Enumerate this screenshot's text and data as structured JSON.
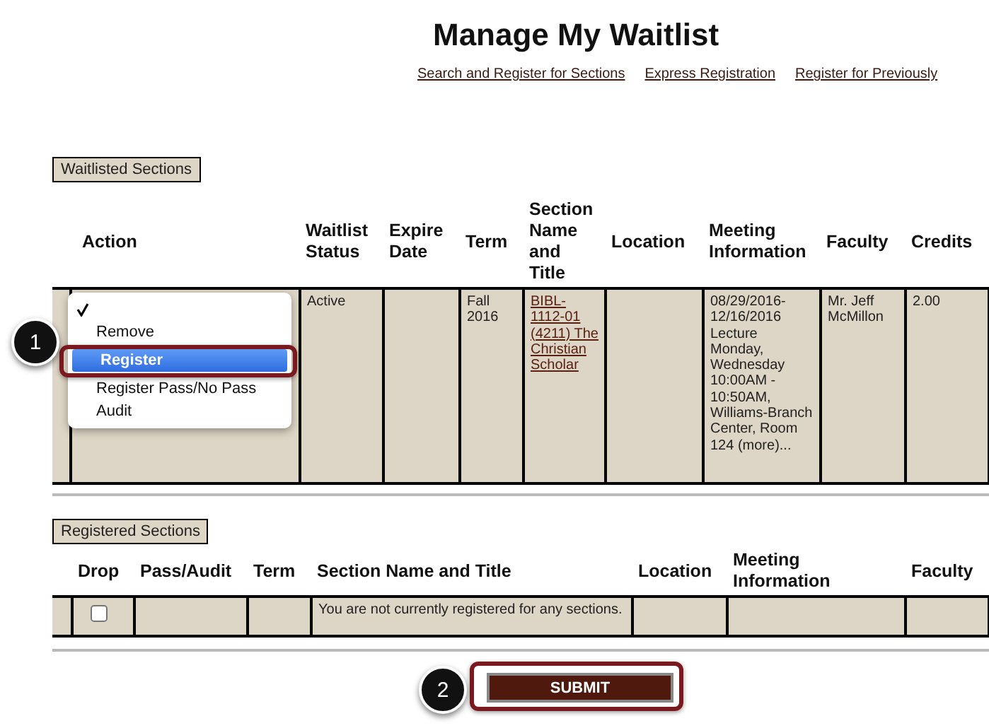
{
  "title": "Manage My Waitlist",
  "links": [
    "Search and Register for Sections",
    "Express Registration",
    "Register for Previously"
  ],
  "waitlisted": {
    "label": "Waitlisted Sections",
    "columns": [
      "Action",
      "Waitlist Status",
      "Expire Date",
      "Term",
      "Section Name and Title",
      "Location",
      "Meeting Information",
      "Faculty",
      "Credits"
    ],
    "rows": [
      {
        "action_menu": {
          "options": [
            {
              "checked": true,
              "selected": false
            },
            {
              "label": "Remove",
              "checked": false,
              "selected": false
            },
            {
              "label": "Register",
              "checked": false,
              "selected": true
            },
            {
              "label": "Register Pass/No Pass",
              "checked": false,
              "selected": false
            },
            {
              "label": "Audit",
              "checked": false,
              "selected": false
            }
          ]
        },
        "status": "Active",
        "term": "Fall 2016",
        "section": "BIBL-1112-01 (4211) The Christian Scholar",
        "meeting": "08/29/2016-12/16/2016 Lecture Monday, Wednesday 10:00AM - 10:50AM, Williams-Branch Center, Room 124 (more)...",
        "faculty": "Mr. Jeff McMillon",
        "credits": "2.00"
      }
    ]
  },
  "registered": {
    "label": "Registered Sections",
    "columns": [
      "Drop",
      "Pass/Audit",
      "Term",
      "Section Name and Title",
      "Location",
      "Meeting Information",
      "Faculty"
    ],
    "rows": [
      {
        "drop_checked": false,
        "message": "You are not currently registered for any sections."
      }
    ]
  },
  "submit": "SUBMIT",
  "callouts": [
    "1",
    "2"
  ]
}
